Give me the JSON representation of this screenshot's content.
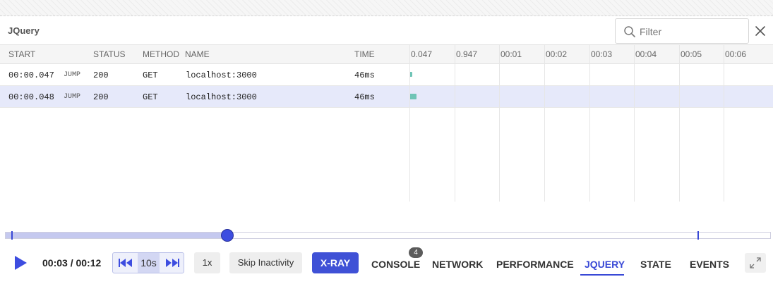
{
  "panel": {
    "title": "JQuery"
  },
  "filter": {
    "placeholder": "Filter",
    "value": ""
  },
  "columns": {
    "start": "START",
    "status": "STATUS",
    "method": "METHOD",
    "name": "NAME",
    "time": "TIME"
  },
  "timeline_ticks": [
    "0.047",
    "0.947",
    "00:01",
    "00:02",
    "00:03",
    "00:04",
    "00:05",
    "00:06"
  ],
  "rows": [
    {
      "start": "00:00.047",
      "jump": "JUMP",
      "status": "200",
      "method": "GET",
      "name": "localhost:3000",
      "time": "46ms"
    },
    {
      "start": "00:00.048",
      "jump": "JUMP",
      "status": "200",
      "method": "GET",
      "name": "localhost:3000",
      "time": "46ms"
    }
  ],
  "player": {
    "time_display": "00:03 / 00:12",
    "progress_fraction": 0.29,
    "skip_interval": "10s",
    "speed": "1x",
    "skip_inactivity": "Skip Inactivity",
    "xray": "X-RAY"
  },
  "tabs": {
    "console": "CONSOLE",
    "console_badge": "4",
    "network": "NETWORK",
    "performance": "PERFORMANCE",
    "jquery": "JQUERY",
    "state": "STATE",
    "events": "EVENTS",
    "active": "JQUERY"
  },
  "colors": {
    "accent": "#3949d6",
    "selected_row": "#e6e9fa",
    "timeline_bar": "#6fc4b6"
  },
  "icons": {
    "search": "search-icon",
    "close": "close-icon",
    "play": "play-icon",
    "rewind": "skip-back-icon",
    "forward": "skip-forward-icon",
    "fullscreen": "fullscreen-icon"
  }
}
